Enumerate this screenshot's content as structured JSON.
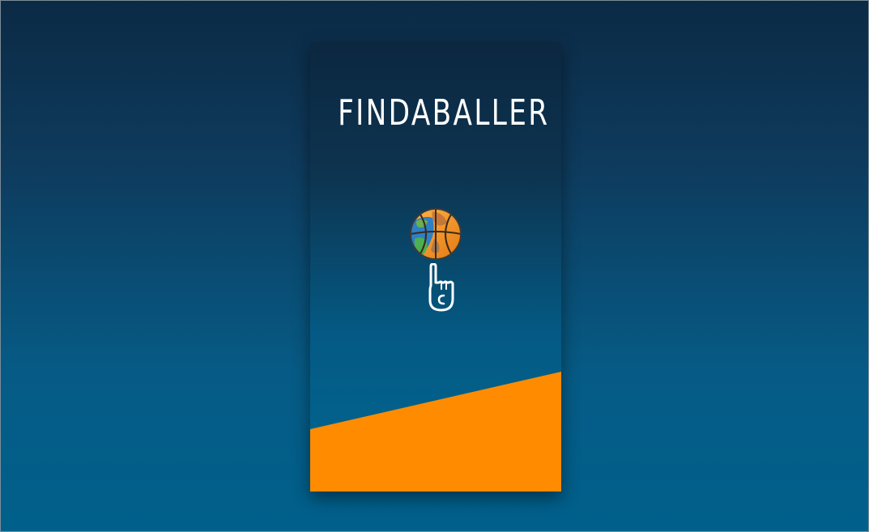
{
  "app": {
    "title": "FINDABALLER"
  },
  "colors": {
    "accent": "#ff8c00",
    "background_top": "#0b2a45",
    "background_bottom": "#00608b",
    "title_text": "#ffffff"
  },
  "icons": {
    "logo_ball": "globe-basketball-icon",
    "logo_hand": "pointing-finger-icon"
  }
}
